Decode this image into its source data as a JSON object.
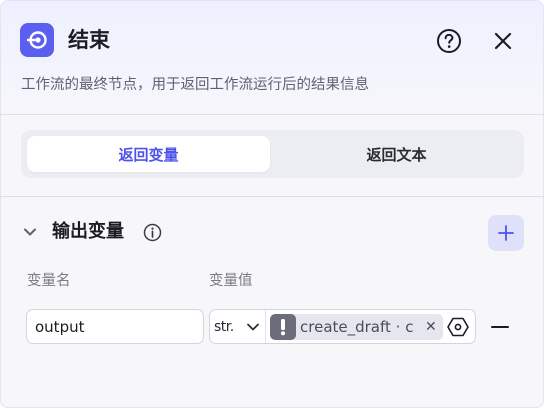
{
  "header": {
    "title": "结束",
    "description": "工作流的最终节点，用于返回工作流运行后的结果信息",
    "icons": {
      "node": "end-node-icon",
      "help": "help-circle-icon",
      "close": "close-icon"
    }
  },
  "tabs": [
    {
      "label": "返回变量",
      "active": true
    },
    {
      "label": "返回文本",
      "active": false
    }
  ],
  "output_section": {
    "title": "输出变量",
    "columns": {
      "name": "变量名",
      "value": "变量值"
    },
    "rows": [
      {
        "name": "output",
        "type": "str.",
        "reference": "create_draft · c"
      }
    ]
  },
  "colors": {
    "accent": "#4d53e8",
    "node_icon_bg": "#5b5ff0",
    "add_button_bg": "#dfe1fb"
  }
}
